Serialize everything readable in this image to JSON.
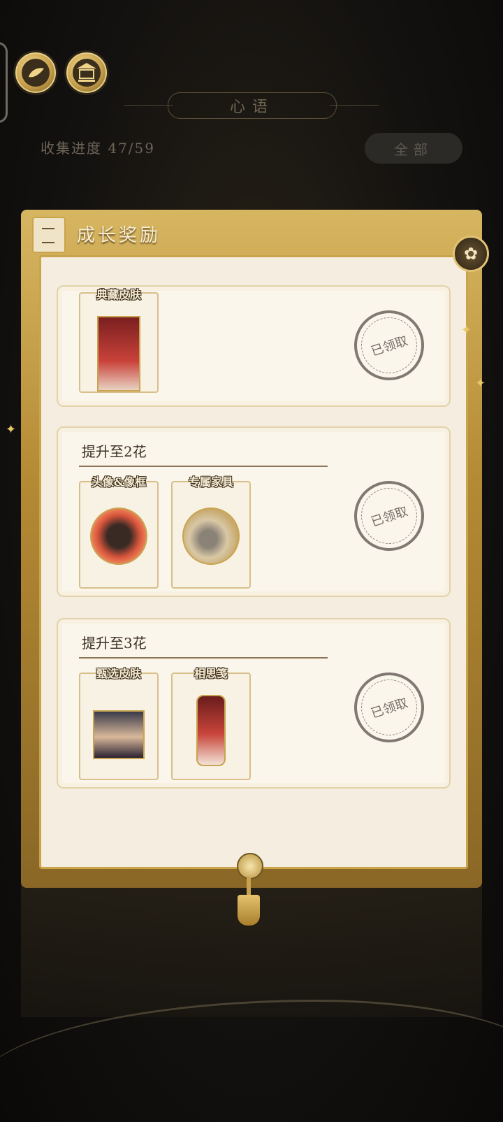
{
  "window": {
    "title": "心语"
  },
  "header": {
    "progress": "收集进度 47/59",
    "filter_label": "全部"
  },
  "panel": {
    "title": "成长奖励",
    "close_icon": "flower-close-icon"
  },
  "tiers": [
    {
      "title": "",
      "items": [
        {
          "label": "典藏皮肤",
          "icon": "skin-card-art"
        }
      ],
      "status": "已领取"
    },
    {
      "title": "提升至2花",
      "items": [
        {
          "label": "头像&像框",
          "icon": "avatar-frame-art"
        },
        {
          "label": "专属家具",
          "icon": "furniture-art"
        }
      ],
      "status": "已领取"
    },
    {
      "title": "提升至3花",
      "items": [
        {
          "label": "甄选皮肤",
          "icon": "portrait-art"
        },
        {
          "label": "相思笺",
          "icon": "letter-card-art"
        }
      ],
      "status": "已领取"
    }
  ],
  "colors": {
    "gold": "#c9a44b",
    "paper": "#f4ede0",
    "stamp": "#6d635e"
  }
}
